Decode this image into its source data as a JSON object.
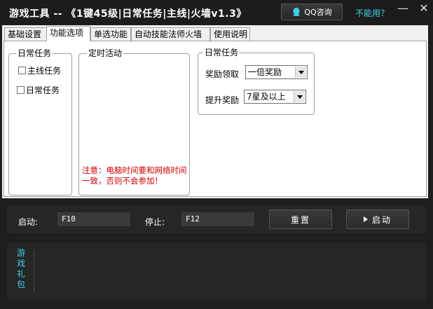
{
  "titlebar": {
    "title": "游戏工具 -- 《1键45级|日常任务|主线|火墙v1.3》",
    "qq_button": "QQ咨询",
    "help_link": "不能用？",
    "minimize": "—",
    "close": "✕"
  },
  "tabs": [
    {
      "label": "基础设置",
      "active": false
    },
    {
      "label": "功能选项",
      "active": true
    },
    {
      "label": "单选功能",
      "active": false
    },
    {
      "label": "自动技能法师火墙",
      "active": false
    },
    {
      "label": "使用说明",
      "active": false
    }
  ],
  "daily_group": {
    "title": "日常任务",
    "checkboxes": [
      "主线任务",
      "日常任务"
    ]
  },
  "timed_group": {
    "title": "定时活动",
    "notice": "注意：电脑时间要和网络时间一致，否则不会参加！"
  },
  "daily_options_group": {
    "title": "日常任务",
    "reward_label": "奖励领取",
    "reward_value": "一倍奖励",
    "upgrade_label": "提升奖励",
    "upgrade_value": "7星及以上"
  },
  "controls": {
    "start_label": "启动:",
    "start_key": "F10",
    "stop_label": "停止:",
    "stop_key": "F12",
    "reset_button": "重置",
    "start_button": "启动"
  },
  "gift": {
    "label": "游戏礼包"
  }
}
